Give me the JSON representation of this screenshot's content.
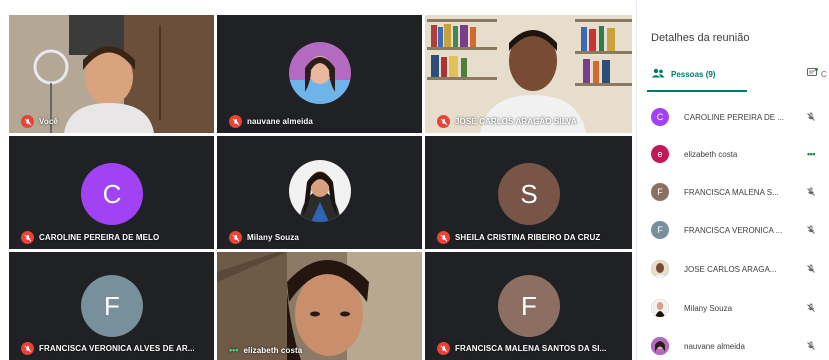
{
  "meeting": {
    "tiles": [
      {
        "name": "Você",
        "kind": "video",
        "muted": true
      },
      {
        "name": "nauvane almeida",
        "kind": "photo",
        "muted": true
      },
      {
        "name": "JOSE CARLOS ARAGÃO SILVA",
        "kind": "video",
        "muted": true
      },
      {
        "name": "CAROLINE PEREIRA DE MELO",
        "kind": "letter",
        "letter": "C",
        "color": "#a142f4",
        "muted": true
      },
      {
        "name": "Milany Souza",
        "kind": "photo",
        "muted": true
      },
      {
        "name": "SHEILA CRISTINA RIBEIRO DA CRUZ",
        "kind": "letter",
        "letter": "S",
        "color": "#795548",
        "muted": true
      },
      {
        "name": "FRANCISCA VERONICA ALVES DE AR...",
        "kind": "letter",
        "letter": "F",
        "color": "#78909c",
        "muted": true
      },
      {
        "name": "elizabeth costa",
        "kind": "video",
        "muted": false,
        "speaking": true
      },
      {
        "name": "FRANCISCA MALENA SANTOS DA SI...",
        "kind": "letter",
        "letter": "F",
        "color": "#8d6e63",
        "muted": true
      }
    ]
  },
  "panel": {
    "title": "Detalhes da reunião",
    "tab_people": "Pessoas (9)",
    "tab_chat": "C",
    "people": [
      {
        "name": "CAROLINE PEREIRA DE ...",
        "letter": "C",
        "color": "#a142f4",
        "status": "muted"
      },
      {
        "name": "elizabeth costa",
        "letter": "e",
        "color": "#c2185b",
        "status": "speaking"
      },
      {
        "name": "FRANCISCA MALENA S...",
        "letter": "F",
        "color": "#8d6e63",
        "status": "muted"
      },
      {
        "name": "FRANCISCA VERONICA ...",
        "letter": "F",
        "color": "#78909c",
        "status": "muted"
      },
      {
        "name": "JOSE CARLOS ARAGA...",
        "letter": "",
        "color": "#6d4c41",
        "status": "muted"
      },
      {
        "name": "Milany Souza",
        "letter": "",
        "color": "#5d4037",
        "status": "muted"
      },
      {
        "name": "nauvane almeida",
        "letter": "",
        "color": "#7b1fa2",
        "status": "muted"
      }
    ]
  },
  "colors": {
    "accent": "#00796b",
    "mic_off": "#ea4335",
    "tile_bg": "#202124"
  }
}
